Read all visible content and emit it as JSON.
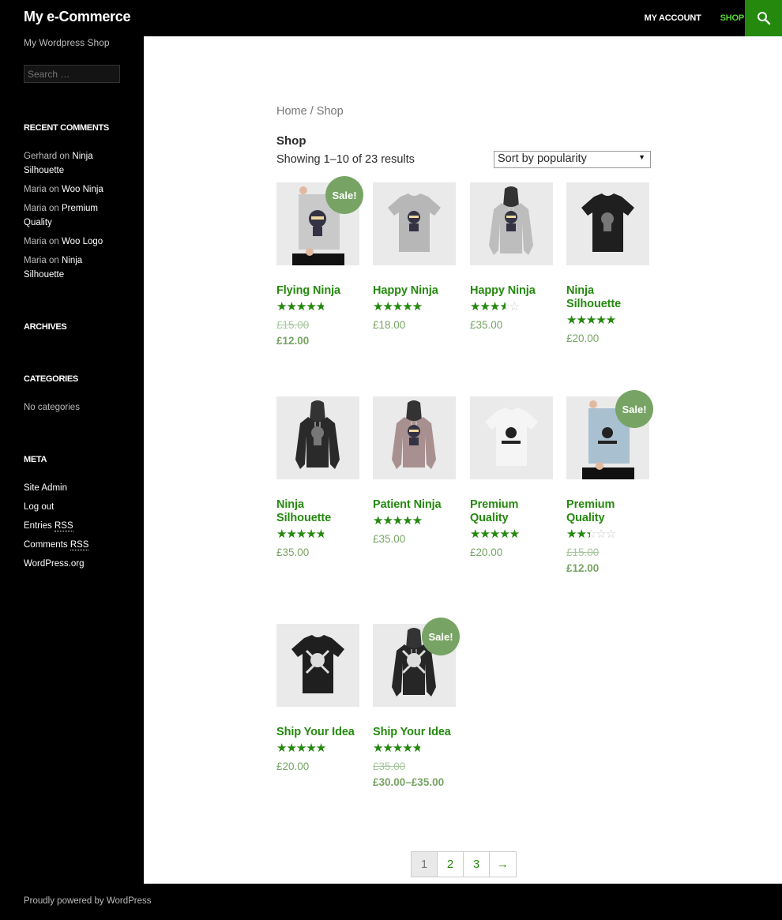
{
  "header": {
    "site_title": "My e-Commerce",
    "nav": [
      {
        "label": "MY ACCOUNT",
        "active": false
      },
      {
        "label": "SHOP",
        "active": true
      }
    ],
    "search_icon": "search-icon",
    "accent_color": "#24890d"
  },
  "sidebar": {
    "tagline": "My Wordpress Shop",
    "search_placeholder": "Search …",
    "recent_comments": {
      "title": "RECENT COMMENTS",
      "items": [
        {
          "author": "Gerhard",
          "on": "on",
          "post": "Ninja Silhouette"
        },
        {
          "author": "Maria",
          "on": "on",
          "post": "Woo Ninja"
        },
        {
          "author": "Maria",
          "on": "on",
          "post": "Premium Quality"
        },
        {
          "author": "Maria",
          "on": "on",
          "post": "Woo Logo"
        },
        {
          "author": "Maria",
          "on": "on",
          "post": "Ninja Silhouette"
        }
      ]
    },
    "archives": {
      "title": "ARCHIVES"
    },
    "categories": {
      "title": "CATEGORIES",
      "empty": "No categories"
    },
    "meta": {
      "title": "META",
      "items": [
        {
          "label": "Site Admin"
        },
        {
          "label": "Log out"
        },
        {
          "label": "Entries",
          "abbr": "RSS"
        },
        {
          "label": "Comments",
          "abbr": "RSS"
        },
        {
          "label": "WordPress.org"
        }
      ]
    }
  },
  "main": {
    "breadcrumb": {
      "home": "Home",
      "sep": " / ",
      "current": "Shop"
    },
    "title": "Shop",
    "result_count": "Showing 1–10 of 23 results",
    "orderby": {
      "selected": "Sort by popularity",
      "arrow": "▼"
    },
    "sale_label": "Sale!",
    "products": [
      {
        "name": "Flying Ninja",
        "rating": 4.0,
        "sale": true,
        "old_price": "£15.00",
        "price": "£12.00",
        "image": "poster-ninja"
      },
      {
        "name": "Happy Ninja",
        "rating": 5.0,
        "sale": false,
        "price": "£18.00",
        "image": "tshirt-grey-ninja"
      },
      {
        "name": "Happy Ninja",
        "rating": 3.0,
        "sale": false,
        "price": "£35.00",
        "image": "hoodie-grey-ninja"
      },
      {
        "name": "Ninja Silhouette",
        "rating": 5.0,
        "sale": false,
        "price": "£20.00",
        "image": "tshirt-black-silhouette"
      },
      {
        "name": "Ninja Silhouette",
        "rating": 4.0,
        "sale": false,
        "price": "£35.00",
        "image": "hoodie-black-silhouette"
      },
      {
        "name": "Patient Ninja",
        "rating": 4.8,
        "sale": false,
        "price": "£35.00",
        "image": "hoodie-pink-ninja"
      },
      {
        "name": "Premium Quality",
        "rating": 4.6,
        "sale": false,
        "price": "£20.00",
        "image": "tshirt-white-woo"
      },
      {
        "name": "Premium Quality",
        "rating": 2.0,
        "sale": true,
        "old_price": "£15.00",
        "price": "£12.00",
        "image": "poster-blue-woo"
      },
      {
        "name": "Ship Your Idea",
        "rating": 4.5,
        "sale": false,
        "price": "£20.00",
        "image": "tshirt-black-skull"
      },
      {
        "name": "Ship Your Idea",
        "rating": 4.0,
        "sale": true,
        "old_price": "£35.00",
        "price": "£30.00–£35.00",
        "image": "hoodie-black-skull"
      }
    ],
    "pagination": {
      "pages": [
        "1",
        "2",
        "3"
      ],
      "current": "1",
      "next": "→"
    }
  },
  "footer": {
    "text": "Proudly powered by WordPress"
  }
}
